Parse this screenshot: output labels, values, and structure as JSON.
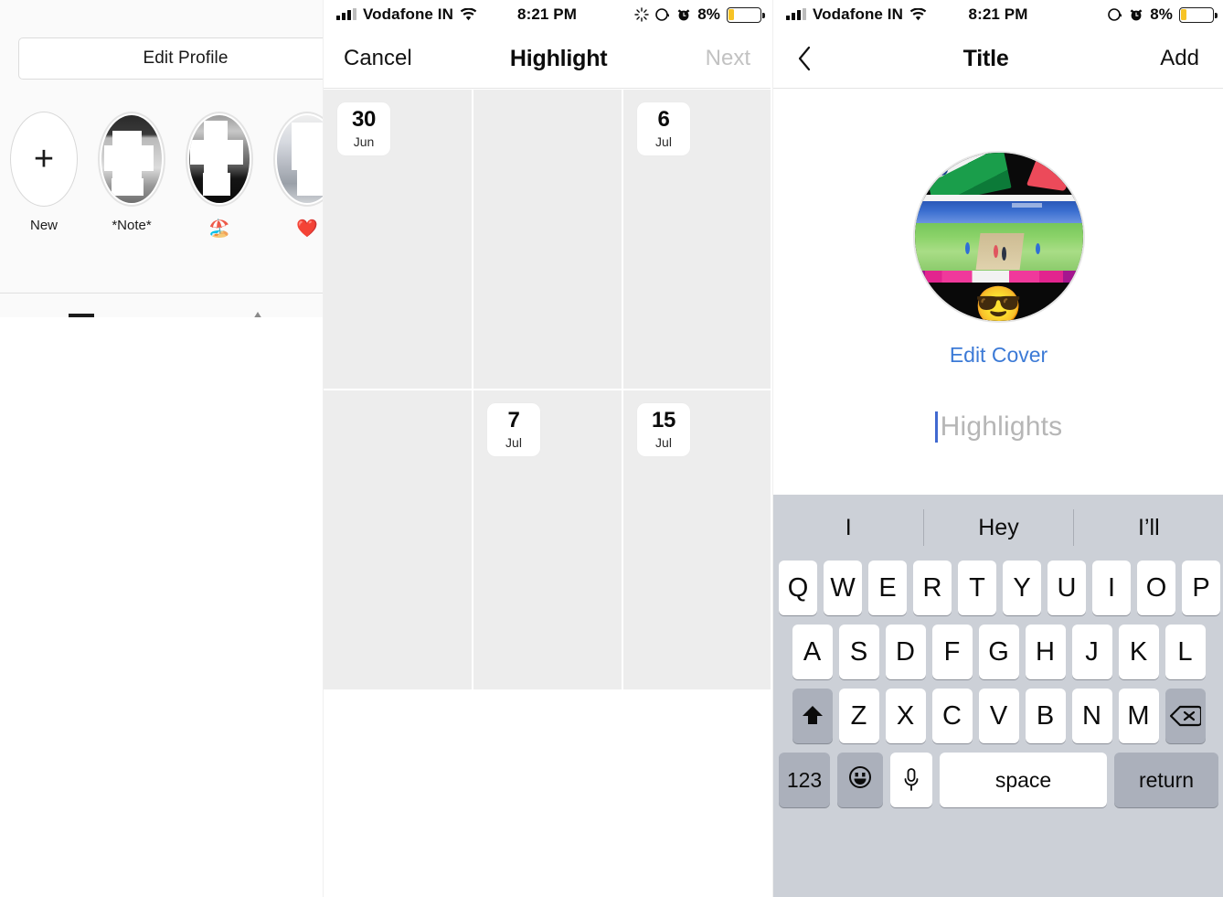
{
  "panels": {
    "profile": {
      "edit_profile_label": "Edit Profile",
      "highlights": [
        {
          "label": "New",
          "type": "new",
          "icon": "plus-icon"
        },
        {
          "label": "*Note*",
          "type": "cover",
          "thumb": "img-a"
        },
        {
          "label": "🏖️",
          "type": "cover",
          "thumb": "img-b"
        },
        {
          "label": "❤️",
          "type": "cover",
          "thumb": "img-c"
        }
      ]
    },
    "highlight_picker": {
      "statusbar": {
        "carrier": "Vodafone IN",
        "time": "8:21 PM",
        "battery_percent": "8%",
        "icons": [
          "signal-icon",
          "wifi-icon",
          "sync-spinner-icon",
          "location-icon",
          "alarm-icon",
          "battery-icon"
        ]
      },
      "nav": {
        "cancel_label": "Cancel",
        "title": "Highlight",
        "next_label": "Next",
        "next_disabled": true
      },
      "grid": {
        "columns": 3,
        "cells": [
          {
            "day": "30",
            "month": "Jun",
            "has_story": true
          },
          {
            "day": "",
            "month": "",
            "has_story": false
          },
          {
            "day": "6",
            "month": "Jul",
            "has_story": true
          },
          {
            "day": "",
            "month": "",
            "has_story": false
          },
          {
            "day": "7",
            "month": "Jul",
            "has_story": true
          },
          {
            "day": "15",
            "month": "Jul",
            "has_story": true
          }
        ]
      }
    },
    "title_entry": {
      "statusbar": {
        "carrier": "Vodafone IN",
        "time": "8:21 PM",
        "battery_percent": "8%",
        "icons": [
          "signal-icon",
          "wifi-icon",
          "location-icon",
          "alarm-icon",
          "battery-icon"
        ]
      },
      "nav": {
        "back_icon": "chevron-left-icon",
        "title": "Title",
        "add_label": "Add"
      },
      "cover": {
        "emoji_overlay": "😎",
        "edit_cover_label": "Edit Cover"
      },
      "title_field": {
        "value": "",
        "placeholder": "Highlights"
      },
      "keyboard": {
        "suggestions": [
          "I",
          "Hey",
          "I’ll"
        ],
        "row1": [
          "Q",
          "W",
          "E",
          "R",
          "T",
          "Y",
          "U",
          "I",
          "O",
          "P"
        ],
        "row2": [
          "A",
          "S",
          "D",
          "F",
          "G",
          "H",
          "J",
          "K",
          "L"
        ],
        "row3": [
          "Z",
          "X",
          "C",
          "V",
          "B",
          "N",
          "M"
        ],
        "shift_icon": "shift-up-arrow-icon",
        "backspace_icon": "backspace-delete-icon",
        "numbers_label": "123",
        "emoji_icon": "smiley-face-icon",
        "dictation_icon": "microphone-icon",
        "space_label": "space",
        "return_label": "return"
      }
    }
  },
  "colors": {
    "accent_blue": "#3c7ad6",
    "caret_blue": "#4169d0",
    "battery_yellow": "#f7c325",
    "grid_cell": "#ededed",
    "keyboard_bg": "#ccd0d7",
    "disabled_text": "#c2c2c2"
  }
}
